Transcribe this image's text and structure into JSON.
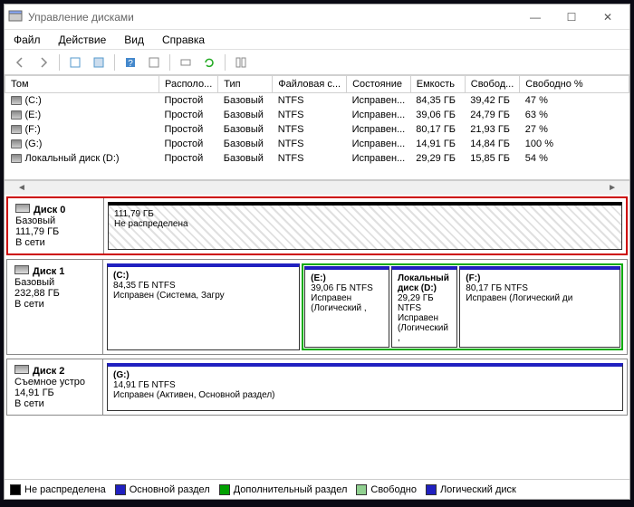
{
  "window": {
    "title": "Управление дисками"
  },
  "menu": {
    "file": "Файл",
    "action": "Действие",
    "view": "Вид",
    "help": "Справка"
  },
  "columns": {
    "volume": "Том",
    "layout": "Располо...",
    "type": "Тип",
    "fs": "Файловая с...",
    "status": "Состояние",
    "capacity": "Емкость",
    "free": "Свобод...",
    "freepct": "Свободно %"
  },
  "volumes": [
    {
      "name": "(C:)",
      "layout": "Простой",
      "type": "Базовый",
      "fs": "NTFS",
      "status": "Исправен...",
      "capacity": "84,35 ГБ",
      "free": "39,42 ГБ",
      "freepct": "47 %"
    },
    {
      "name": "(E:)",
      "layout": "Простой",
      "type": "Базовый",
      "fs": "NTFS",
      "status": "Исправен...",
      "capacity": "39,06 ГБ",
      "free": "24,79 ГБ",
      "freepct": "63 %"
    },
    {
      "name": "(F:)",
      "layout": "Простой",
      "type": "Базовый",
      "fs": "NTFS",
      "status": "Исправен...",
      "capacity": "80,17 ГБ",
      "free": "21,93 ГБ",
      "freepct": "27 %"
    },
    {
      "name": "(G:)",
      "layout": "Простой",
      "type": "Базовый",
      "fs": "NTFS",
      "status": "Исправен...",
      "capacity": "14,91 ГБ",
      "free": "14,84 ГБ",
      "freepct": "100 %"
    },
    {
      "name": "Локальный диск (D:)",
      "layout": "Простой",
      "type": "Базовый",
      "fs": "NTFS",
      "status": "Исправен...",
      "capacity": "29,29 ГБ",
      "free": "15,85 ГБ",
      "freepct": "54 %"
    }
  ],
  "disks": [
    {
      "name": "Диск 0",
      "type": "Базовый",
      "size": "111,79 ГБ",
      "status": "В сети",
      "highlight": true,
      "parts": [
        {
          "kind": "unalloc",
          "size": "111,79 ГБ",
          "status": "Не распределена",
          "flex": 1
        }
      ]
    },
    {
      "name": "Диск 1",
      "type": "Базовый",
      "size": "232,88 ГБ",
      "status": "В сети",
      "parts": [
        {
          "kind": "primary",
          "label": "(C:)",
          "size": "84,35 ГБ NTFS",
          "status": "Исправен (Система, Загру",
          "flex": 84
        },
        {
          "kind": "logicalgroup",
          "flex": 148,
          "children": [
            {
              "kind": "logical",
              "label": "(E:)",
              "size": "39,06 ГБ NTFS",
              "status": "Исправен (Логический ,",
              "flex": 39
            },
            {
              "kind": "logical",
              "label": "Локальный диск  (D:)",
              "size": "29,29 ГБ NTFS",
              "status": "Исправен (Логический ,",
              "flex": 29
            },
            {
              "kind": "logical",
              "label": "(F:)",
              "size": "80,17 ГБ NTFS",
              "status": "Исправен (Логический ди",
              "flex": 80
            }
          ]
        }
      ]
    },
    {
      "name": "Диск 2",
      "type": "Съемное устро",
      "size": "14,91 ГБ",
      "status": "В сети",
      "parts": [
        {
          "kind": "primary",
          "label": "(G:)",
          "size": "14,91 ГБ NTFS",
          "status": "Исправен (Активен, Основной раздел)",
          "flex": 1
        }
      ]
    }
  ],
  "legend": {
    "unalloc": "Не распределена",
    "primary": "Основной раздел",
    "extended": "Дополнительный раздел",
    "free": "Свободно",
    "logical": "Логический диск"
  },
  "colors": {
    "unalloc": "#000000",
    "primary": "#2020c0",
    "extended": "#00a000",
    "free": "#90d090",
    "logical": "#2020c0"
  }
}
